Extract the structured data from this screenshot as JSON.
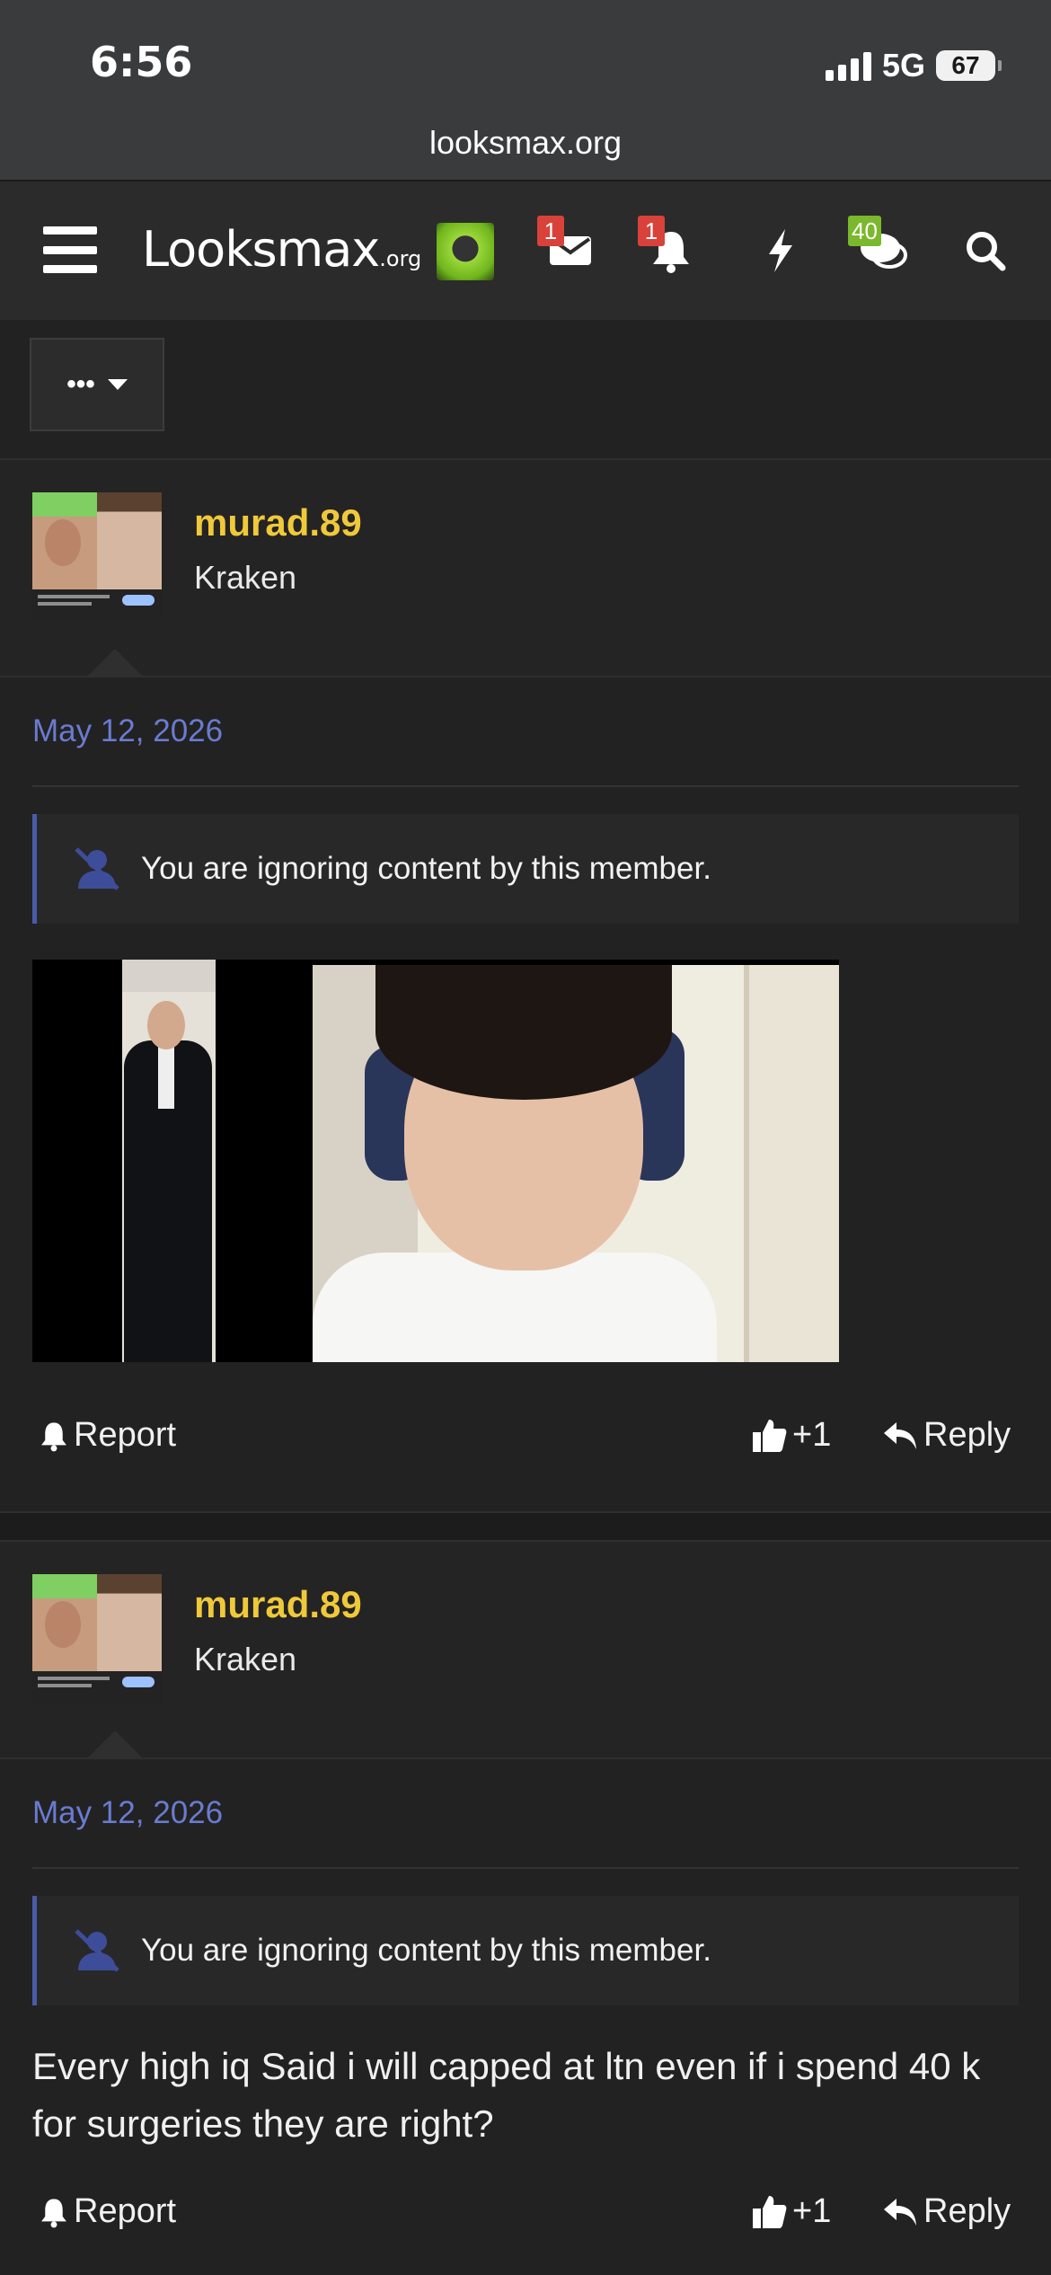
{
  "status_bar": {
    "time": "6:56",
    "network": "5G",
    "battery": "67",
    "url": "looksmax.org"
  },
  "navbar": {
    "logo_main": "Looksmax",
    "logo_suffix": ".org",
    "badges": {
      "messages": "1",
      "alerts": "1",
      "whats_new": "40"
    },
    "icons": [
      "menu-icon",
      "envelope-icon",
      "bell-icon",
      "bolt-icon",
      "chat-bubbles-icon",
      "search-icon"
    ]
  },
  "toolbar": {
    "more_label": "•••"
  },
  "posts": [
    {
      "username": "murad.89",
      "user_title": "Kraken",
      "date": "May 12, 2026",
      "ignore_notice": "You are ignoring content by this member.",
      "has_image": true,
      "text": "",
      "report_label": "Report",
      "like_label": "+1",
      "reply_label": "Reply"
    },
    {
      "username": "murad.89",
      "user_title": "Kraken",
      "date": "May 12, 2026",
      "ignore_notice": "You are ignoring content by this member.",
      "has_image": false,
      "text": "Every high iq Said i will capped at ltn even if i spend 40 k for surgeries they are right?",
      "report_label": "Report",
      "like_label": "+1",
      "reply_label": "Reply"
    }
  ],
  "colors": {
    "username": "#f0c93a",
    "date": "#6a7bd0",
    "ignore_border": "#4a5ba8",
    "badge_red": "#d9423a",
    "badge_green": "#7ab82d"
  }
}
